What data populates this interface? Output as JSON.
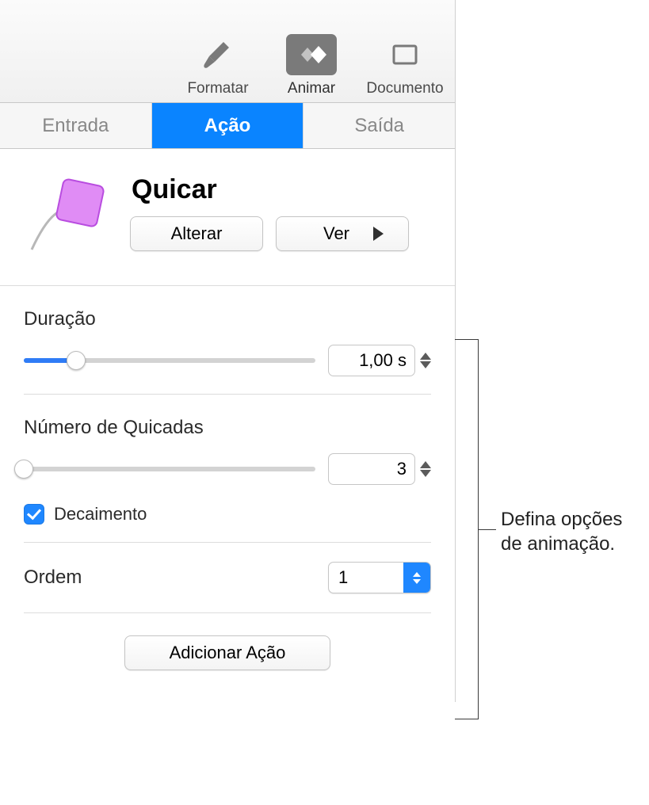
{
  "toolbar": {
    "format": "Formatar",
    "animate": "Animar",
    "document": "Documento"
  },
  "tabs": {
    "in": "Entrada",
    "action": "Ação",
    "out": "Saída"
  },
  "effect": {
    "title": "Quicar",
    "change": "Alterar",
    "preview": "Ver"
  },
  "duration": {
    "label": "Duração",
    "value": "1,00 s",
    "slider_percent": 18
  },
  "bounces": {
    "label": "Número de Quicadas",
    "value": "3",
    "slider_percent": 0,
    "decay_label": "Decaimento",
    "decay_checked": true
  },
  "order": {
    "label": "Ordem",
    "value": "1"
  },
  "footer": {
    "add": "Adicionar Ação"
  },
  "callout": "Defina opções de animação."
}
